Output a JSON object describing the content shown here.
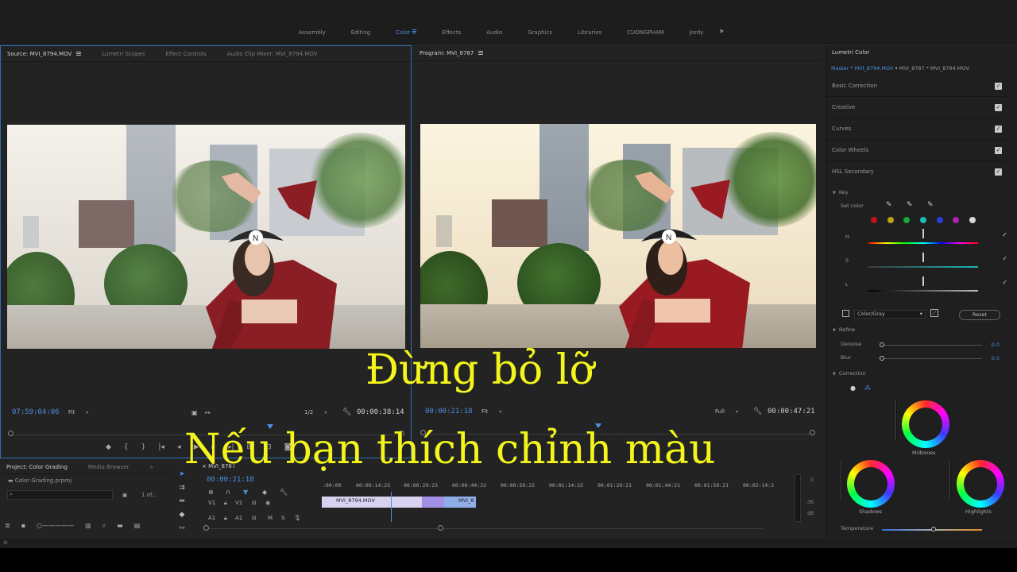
{
  "workspace": {
    "tabs": [
      "Assembly",
      "Editing",
      "Color",
      "Effects",
      "Audio",
      "Graphics",
      "Libraries",
      "CUONGPHAM",
      "Jordy"
    ],
    "active_tab": "Color",
    "more": "»"
  },
  "source_monitor": {
    "tabs": [
      "Source: MVI_8794.MOV",
      "Lumetri Scopes",
      "Effect Controls",
      "Audio Clip Mixer: MVI_8794.MOV"
    ],
    "timecode": "07:59:04:06",
    "fit": "Fit",
    "resolution": "1/2",
    "duration": "00:00:38:14"
  },
  "program_monitor": {
    "tab": "Program: MVI_8787",
    "timecode": "00:00:21:18",
    "fit": "Fit",
    "resolution": "Full",
    "duration": "00:00:47:21"
  },
  "overlay": {
    "line1": "Đừng bỏ lỡ",
    "line2": "Nếu bạn thích chỉnh màu",
    "color": "#f3f51c"
  },
  "project": {
    "tabs": [
      "Project: Color Grading",
      "Media Browser"
    ],
    "file": "Color Grading.prproj",
    "count": "1 of..."
  },
  "timeline": {
    "tab": "MVI_8787",
    "timecode": "00:00:21:18",
    "ruler": [
      ":00:00",
      "00:00:14:23",
      "00:00:29:23",
      "00:00:44:22",
      "00:00:59:22",
      "00:01:14:22",
      "00:01:29:21",
      "00:01:44:21",
      "00:01:59:21",
      "00:02:14:2"
    ],
    "tracks": {
      "v1": "V1",
      "a1": "A1",
      "v1_target": "V1",
      "a1_target": "A1"
    },
    "clips": [
      "MVI_8794.MOV",
      "MVI_8"
    ],
    "meter_labels": [
      "0",
      "-36",
      "dB"
    ]
  },
  "lumetri": {
    "title": "Lumetri Color",
    "master_clip": "Master * MVI_8794.MOV",
    "sequence_clip": "MVI_8787 * MVI_8794.MOV",
    "sections": [
      "Basic Correction",
      "Creative",
      "Curves",
      "Color Wheels",
      "HSL Secondary"
    ],
    "key_label": "Key",
    "set_color_label": "Set color",
    "swatch_colors": [
      "#c0141a",
      "#b8a414",
      "#18a83c",
      "#1ab8b8",
      "#2c3ee0",
      "#b01eb8",
      "#d8d8d8"
    ],
    "h_label": "H",
    "s_label": "S",
    "l_label": "L",
    "color_gray_value": "Color/Gray",
    "reset_label": "Reset",
    "refine_label": "Refine",
    "denoise_label": "Denoise",
    "denoise_value": "0.0",
    "blur_label": "Blur",
    "blur_value": "0.0",
    "correction_label": "Correction",
    "midtones_label": "Midtones",
    "shadows_label": "Shadows",
    "highlights_label": "Highlights",
    "temperature_label": "Temperature"
  }
}
